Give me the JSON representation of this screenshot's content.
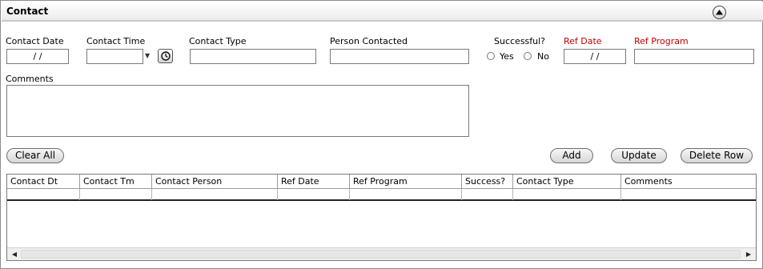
{
  "header": {
    "title": "Contact"
  },
  "icons": {
    "collapse": "collapse-up-icon",
    "clock": "clock-icon",
    "dropdown": "dropdown-arrow-icon"
  },
  "colors": {
    "required_label": "#c00000"
  },
  "form": {
    "contact_date": {
      "label": "Contact Date",
      "value": "/ /"
    },
    "contact_time": {
      "label": "Contact Time",
      "value": ""
    },
    "contact_type": {
      "label": "Contact Type",
      "value": ""
    },
    "person_contacted": {
      "label": "Person Contacted",
      "value": ""
    },
    "successful": {
      "label": "Successful?",
      "yes_label": "Yes",
      "no_label": "No"
    },
    "ref_date": {
      "label": "Ref Date",
      "value": "/ /"
    },
    "ref_program": {
      "label": "Ref Program",
      "value": ""
    },
    "comments": {
      "label": "Comments",
      "value": ""
    }
  },
  "buttons": {
    "clear_all": "Clear All",
    "add": "Add",
    "update": "Update",
    "delete_row": "Delete Row"
  },
  "grid": {
    "columns": [
      "Contact Dt",
      "Contact Tm",
      "Contact Person",
      "Ref Date",
      "Ref Program",
      "Success?",
      "Contact Type",
      "Comments"
    ]
  }
}
